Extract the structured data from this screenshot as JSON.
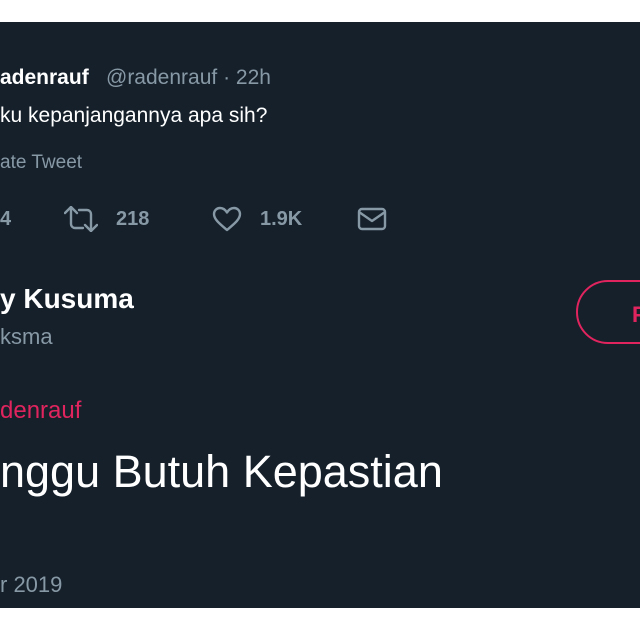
{
  "original_tweet": {
    "display_name": "adenrauf",
    "handle": "@radenrauf",
    "separator": "·",
    "time": "22h",
    "text": "ku kepanjangannya apa sih?",
    "translate_label": "ate Tweet",
    "actions": {
      "reply_count": "4",
      "retweet_count": "218",
      "like_count": "1.9K"
    }
  },
  "reply": {
    "display_name": "y Kusuma",
    "handle": "ksma",
    "follow_label": "F",
    "replying_to": "denrauf",
    "text": "nggu Butuh Kepastian",
    "date": "r 2019"
  },
  "colors": {
    "background": "#15202b",
    "text_primary": "#ffffff",
    "text_secondary": "#8899a6",
    "accent": "#e0245e",
    "divider": "#38444d"
  },
  "icons": [
    "retweet-icon",
    "heart-icon",
    "mail-icon"
  ]
}
